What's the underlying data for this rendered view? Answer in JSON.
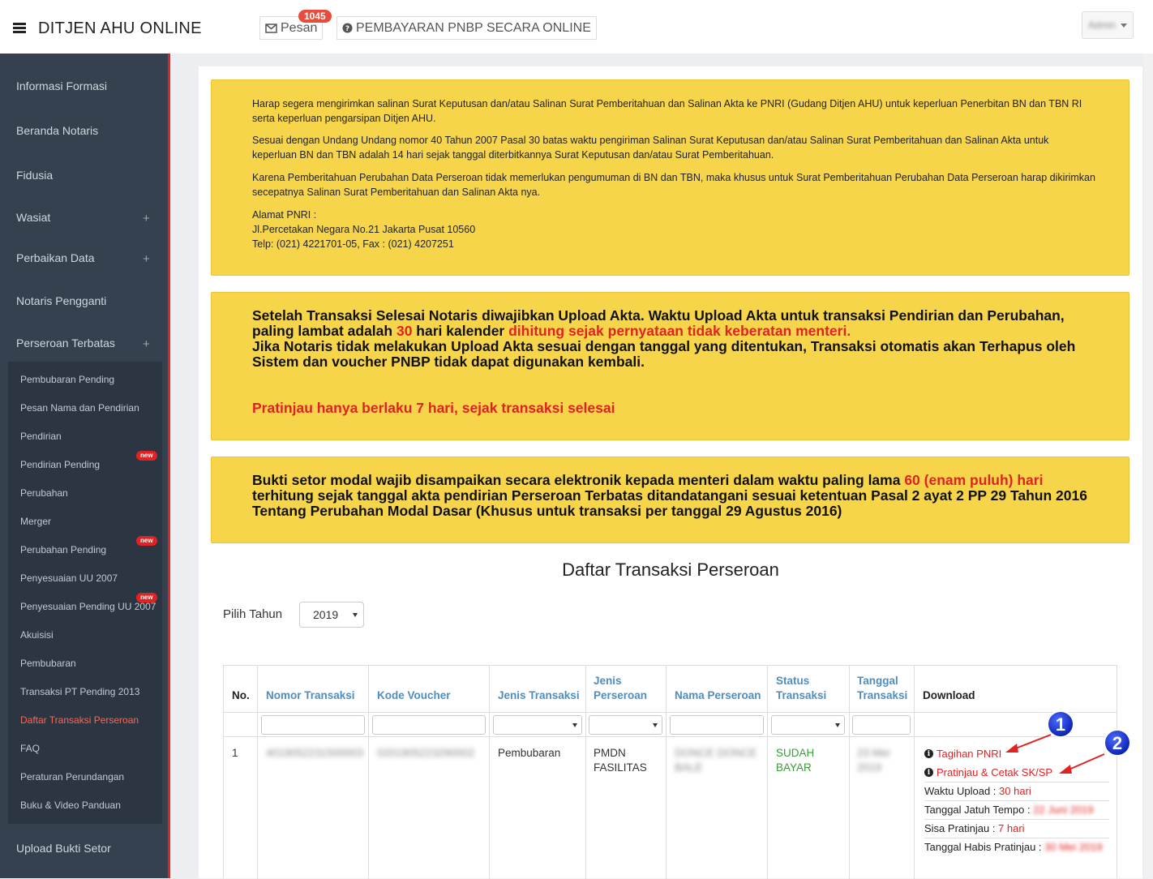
{
  "header": {
    "app_title": "DITJEN AHU ONLINE",
    "pesan_label": "Pesan",
    "pesan_count": "1045",
    "pnbp_label": "PEMBAYARAN PNBP SECARA ONLINE",
    "user_name": "Admin"
  },
  "sidebar": {
    "items": [
      {
        "label": "Informasi Formasi"
      },
      {
        "label": "Beranda Notaris"
      },
      {
        "label": "Fidusia"
      },
      {
        "label": "Wasiat",
        "expand": "+"
      },
      {
        "label": "Perbaikan Data",
        "expand": "+"
      },
      {
        "label": "Notaris Pengganti"
      },
      {
        "label": "Perseroan Terbatas",
        "expand": "+"
      }
    ],
    "submenu": [
      {
        "label": "Pembubaran Pending"
      },
      {
        "label": "Pesan Nama dan Pendirian"
      },
      {
        "label": "Pendirian"
      },
      {
        "label": "Pendirian Pending",
        "badge": "new"
      },
      {
        "label": "Perubahan"
      },
      {
        "label": "Merger"
      },
      {
        "label": "Perubahan Pending",
        "badge": "new"
      },
      {
        "label": "Penyesuaian UU 2007"
      },
      {
        "label": "Penyesuaian Pending UU 2007",
        "badge": "new"
      },
      {
        "label": "Akuisisi"
      },
      {
        "label": "Pembubaran"
      },
      {
        "label": "Transaksi PT Pending 2013"
      },
      {
        "label": "Daftar Transaksi Perseroan"
      },
      {
        "label": "FAQ"
      },
      {
        "label": "Peraturan Perundangan"
      },
      {
        "label": "Buku & Video Panduan"
      }
    ],
    "bottom_item": "Upload Bukti Setor"
  },
  "alert1": {
    "p1": "Harap segera mengirimkan salinan Surat Keputusan dan/atau Salinan Surat Pemberitahuan dan Salinan Akta ke PNRI (Gudang Ditjen AHU) untuk keperluan Penerbitan BN dan TBN RI serta keperluan pengarsipan Ditjen AHU.",
    "p2": "Sesuai dengan Undang Undang nomor 40 Tahun 2007 Pasal 30 batas waktu pengiriman Salinan Surat Keputusan dan/atau Salinan Surat Pemberitahuan dan Salinan Akta untuk keperluan BN dan TBN adalah 14 hari sejak tanggal diterbitkannya Surat Keputusan dan/atau Surat Pemberitahuan.",
    "p3": "Karena Pemberitahuan Perubahan Data Perseroan tidak memerlukan pengumuman di BN dan TBN, maka khusus untuk Surat Pemberitahuan Perubahan Data Perseroan harap dikirimkan secepatnya Salinan Surat Pemberitahuan dan Salinan Akta nya.",
    "addr1": "Alamat PNRI :",
    "addr2": "Jl.Percetakan Negara No.21 Jakarta Pusat 10560",
    "addr3": "Telp: (021) 4221701-05, Fax : (021) 4207251"
  },
  "alert2": {
    "t1": "Setelah Transaksi Selesai Notaris diwajibkan Upload Akta. Waktu Upload Akta untuk transaksi Pendirian dan Perubahan, paling lambat adalah ",
    "t2": "30",
    "t3": " hari kalender ",
    "t4": "dihitung sejak pernyataan tidak keberatan menteri.",
    "t5": "Jika Notaris tidak melakukan Upload Akta sesuai dengan tanggal yang ditentukan, Transaksi otomatis akan Terhapus oleh Sistem dan voucher PNBP tidak dapat digunakan kembali.",
    "t6": "Pratinjau hanya berlaku 7 hari, sejak transaksi selesai"
  },
  "alert3": {
    "t1": "Bukti setor modal wajib disampaikan secara elektronik kepada menteri dalam waktu paling lama ",
    "t2": "60 (enam puluh) hari",
    "t3": " terhitung sejak tanggal akta pendirian Perseroan Terbatas ditandatangani sesuai ketentuan Pasal 2 ayat 2 PP 29 Tahun 2016 Tentang Perubahan Modal Dasar (Khusus untuk transaksi per tanggal 29 Agustus 2016)"
  },
  "section_title": "Daftar Transaksi Perseroan",
  "year_filter": {
    "label": "Pilih Tahun",
    "value": "2019"
  },
  "table": {
    "headers": {
      "no": "No.",
      "nomor": "Nomor Transaksi",
      "kode": "Kode Voucher",
      "jenis_trans": "Jenis Transaksi",
      "jenis_pers_1": "Jenis",
      "jenis_pers_2": "Perseroan",
      "nama": "Nama Perseroan",
      "status_1": "Status",
      "status_2": "Transaksi",
      "tanggal_1": "Tanggal",
      "tanggal_2": "Transaksi",
      "download": "Download"
    },
    "row": {
      "no": "1",
      "nomor": "4019052231500003",
      "kode": "0201905223290002",
      "jenis_trans": "Pembubaran",
      "jenis_pers_1": "PMDN",
      "jenis_pers_2": "FASILITAS",
      "nama_1": "DONCE DONCE",
      "nama_2": "BALE",
      "status_1": "SUDAH",
      "status_2": "BAYAR",
      "tanggal_1": "23 Mei",
      "tanggal_2": "2019",
      "link1": "Tagihan PNRI",
      "link2": "Pratinjau & Cetak SK/SP",
      "waktu_label": "Waktu Upload : ",
      "waktu_val": "30 hari",
      "jatuh_label": "Tanggal Jatuh Tempo : ",
      "jatuh_val": "22 Juni 2019",
      "sisa_label": "Sisa Pratinjau : ",
      "sisa_val": "7 hari",
      "habis_label": "Tanggal Habis Pratinjau : ",
      "habis_val": "30 Mei 2019"
    }
  },
  "annotations": [
    {
      "number": "1"
    },
    {
      "number": "2"
    }
  ],
  "colors": {
    "accent": "#e02222",
    "alert_bg": "#f7d54a",
    "sidebar_bg": "#364150",
    "link_blue": "#4d8ec1"
  }
}
